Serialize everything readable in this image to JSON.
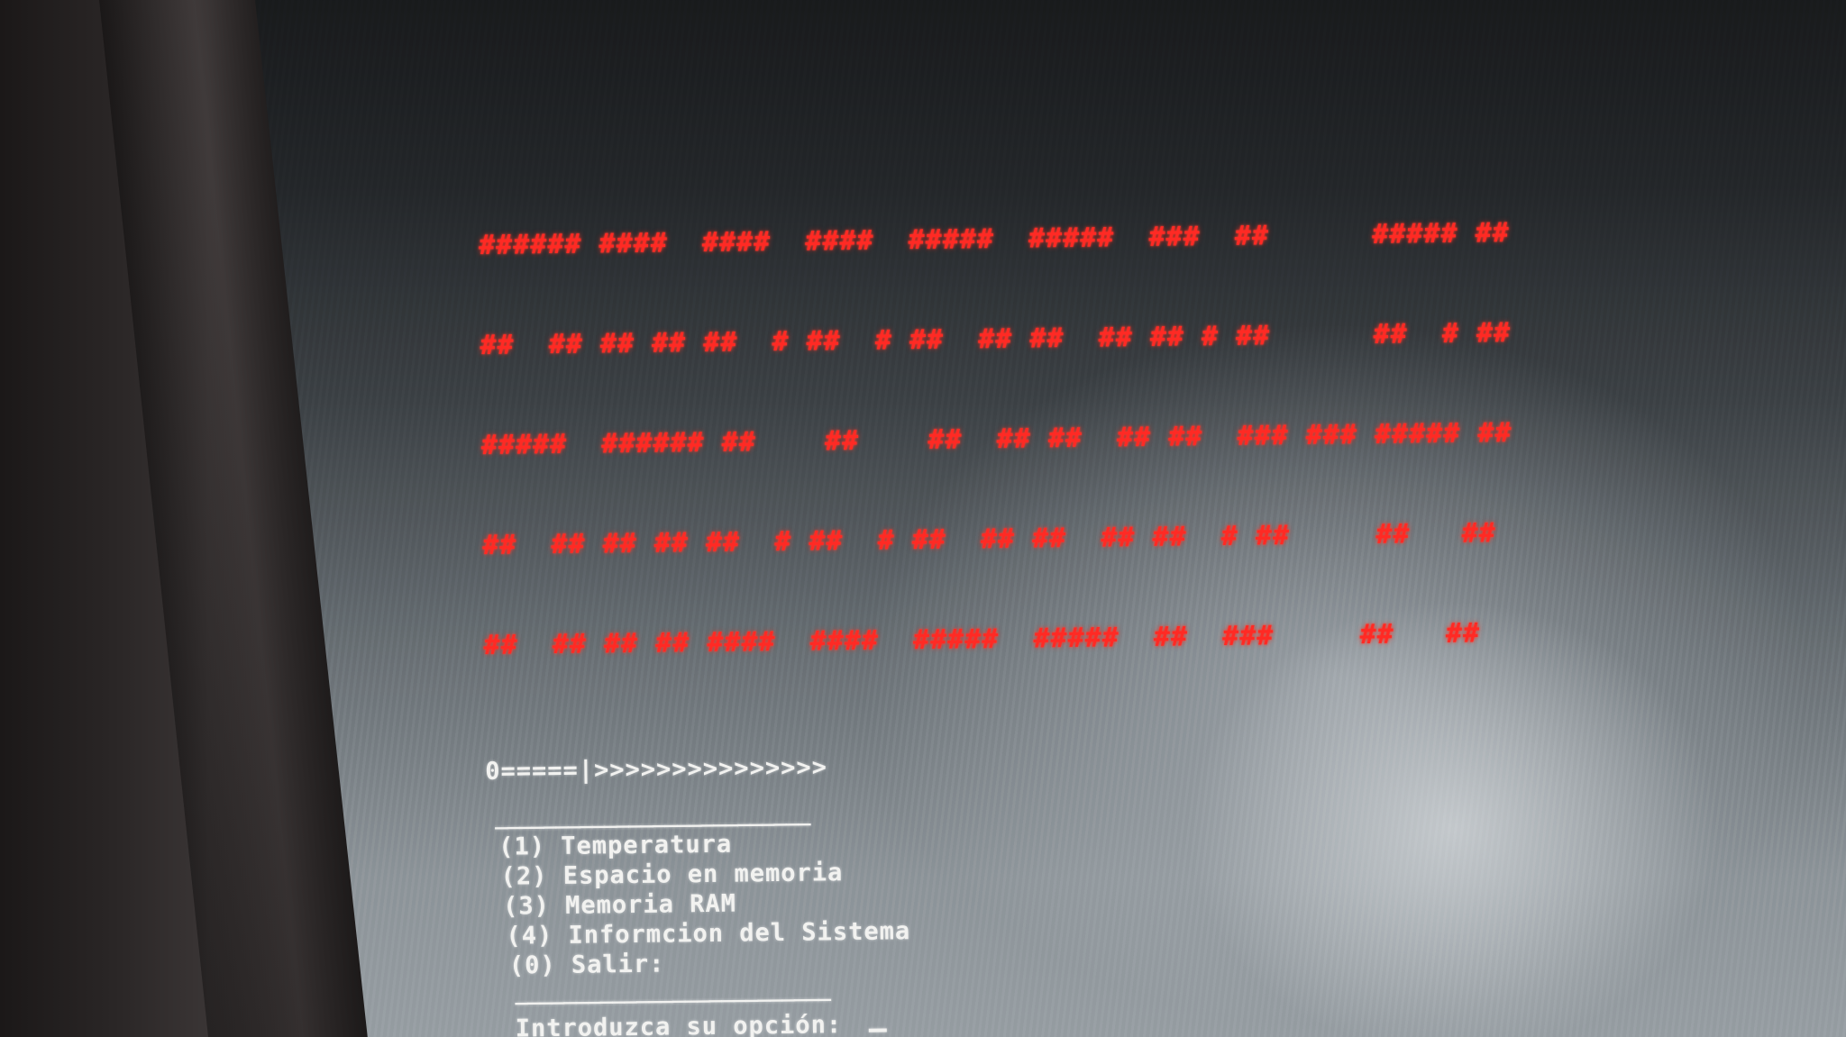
{
  "banner": {
    "lines": [
      "###### ####  ####  ####  #####  #####  ###  ##      ##### ##",
      "##  ## ## ## ##  # ##  # ##  ## ##  ## ## # ##      ##  # ##",
      "#####  ###### ##    ##    ##  ## ##  ## ##  ### ### ##### ##",
      "##  ## ## ## ##  # ##  # ##  ## ##  ## ##  # ##     ##   ##",
      "##  ## ## ## ####  ####  #####  #####  ##  ###     ##   ##"
    ],
    "color": "#ff2a24",
    "reads_as": "RACCOON-PI"
  },
  "progress": {
    "text": "0=====|>>>>>>>>>>>>>>>"
  },
  "separator": {
    "text": "__________________________"
  },
  "menu": {
    "items": [
      {
        "label": "(1) Temperatura"
      },
      {
        "label": "(2) Espacio en memoria"
      },
      {
        "label": "(3) Memoria RAM"
      },
      {
        "label": "(4) Informcion del Sistema"
      },
      {
        "label": "(0) Salir:"
      }
    ]
  },
  "separator_bottom": {
    "text": "__________________________"
  },
  "prompt": {
    "label": "Introduzca su opción:"
  },
  "colors": {
    "terminal_text": "#f2f2f0",
    "banner_red": "#ff2a24"
  }
}
